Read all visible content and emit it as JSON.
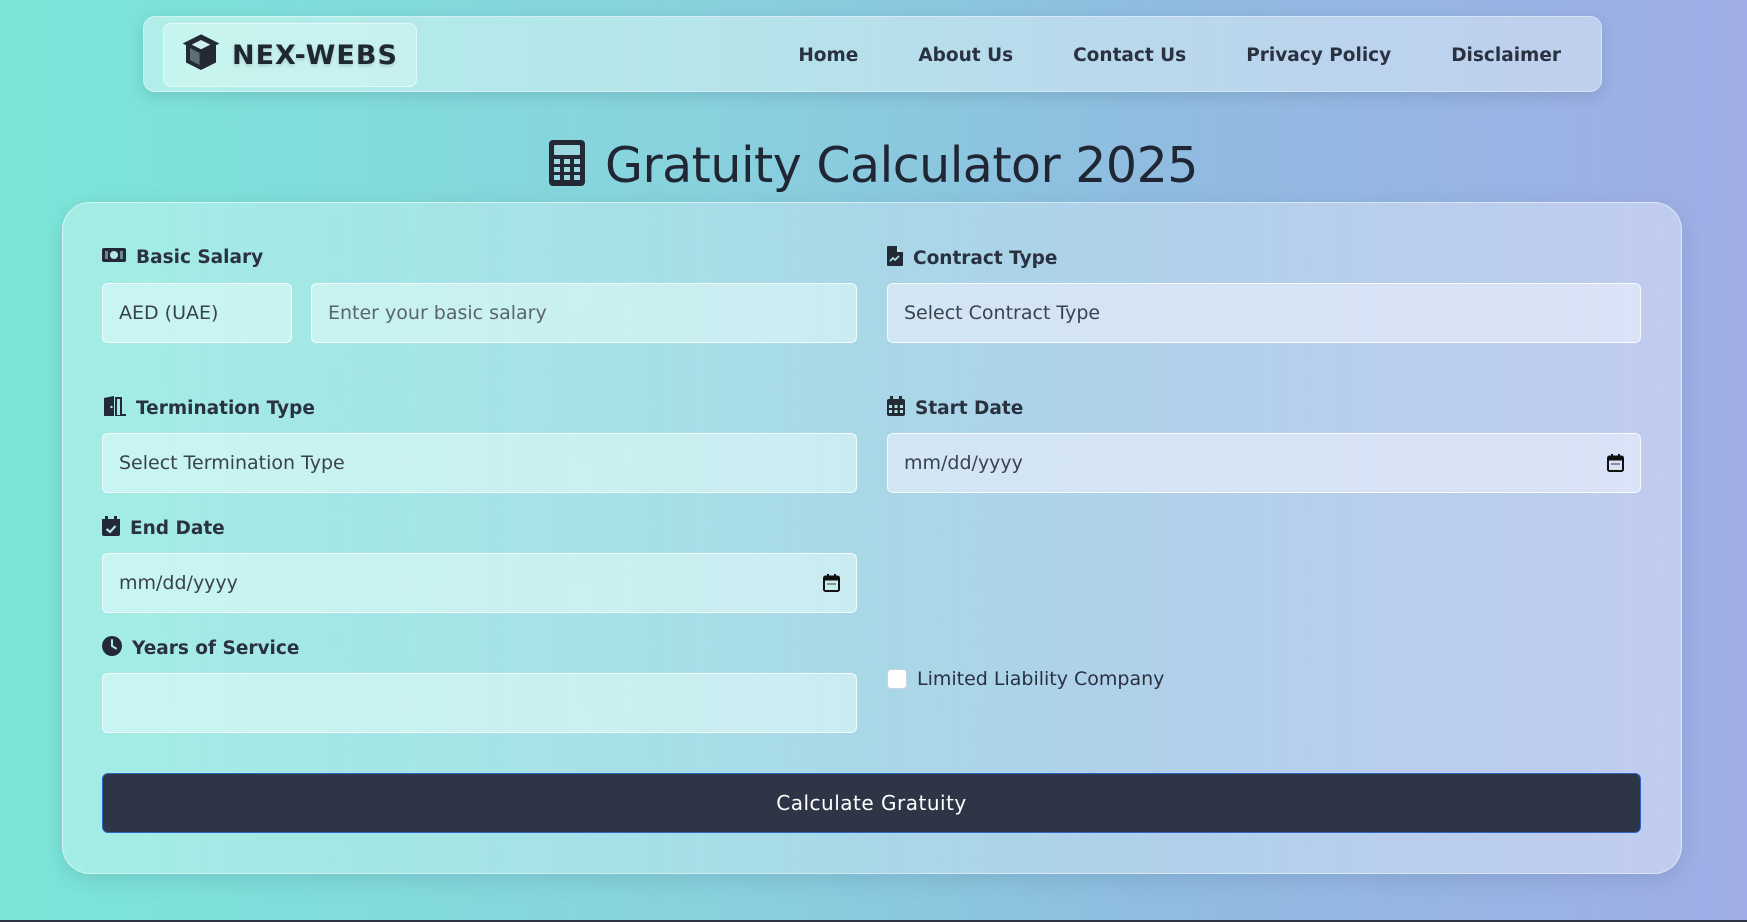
{
  "nav": {
    "brand": "NEX-WEBS",
    "brand_icon": "cube-icon",
    "links": [
      "Home",
      "About Us",
      "Contact Us",
      "Privacy Policy",
      "Disclaimer"
    ]
  },
  "title": {
    "icon": "calculator-icon",
    "text": "Gratuity Calculator 2025"
  },
  "form": {
    "basic_salary": {
      "label": "Basic Salary",
      "icon": "money-icon",
      "currency": "AED (UAE)",
      "placeholder": "Enter your basic salary"
    },
    "contract_type": {
      "label": "Contract Type",
      "icon": "contract-icon",
      "selected": "Select Contract Type"
    },
    "termination_type": {
      "label": "Termination Type",
      "icon": "door-icon",
      "selected": "Select Termination Type"
    },
    "start_date": {
      "label": "Start Date",
      "icon": "calendar-icon",
      "placeholder": "mm/dd/yyyy"
    },
    "end_date": {
      "label": "End Date",
      "icon": "calendar-check-icon",
      "placeholder": "mm/dd/yyyy"
    },
    "years_of_service": {
      "label": "Years of Service",
      "icon": "clock-icon",
      "value": ""
    },
    "llc": {
      "label": "Limited Liability Company",
      "checked": false
    },
    "submit": "Calculate Gratuity"
  },
  "colors": {
    "button_bg": "#2e3546",
    "text": "#2a3140",
    "button_border": "#2f63c4"
  }
}
